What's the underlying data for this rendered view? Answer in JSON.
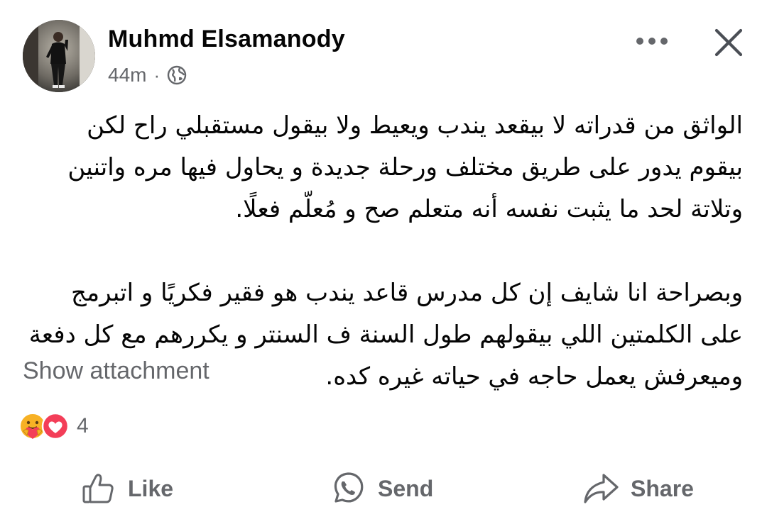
{
  "post": {
    "author": "Muhmd Elsamanody",
    "time": "44m",
    "separator": "·",
    "privacy_icon": "globe-icon",
    "paragraphs": [
      [
        "الواثق من قدراته لا بيقعد يندب ويعيط ولا بيقول مستقبلي راح لكن",
        "بيقوم يدور على طريق مختلف ورحلة جديدة و يحاول فيها مره واتنين",
        "وتلاتة لحد ما يثبت نفسه أنه متعلم صح و مُعلّم فعلًا."
      ],
      [
        "وبصراحة انا شايف إن كل مدرس قاعد يندب هو فقير فكريًا و اتبرمج",
        "على الكلمتين اللي بيقولهم طول السنة ف السنتر و يكررهم مع كل دفعة",
        "وميعرفش يعمل حاجه في حياته غيره كده."
      ]
    ],
    "show_attachment": "Show attachment"
  },
  "reactions": {
    "icons": [
      "care-reaction-icon",
      "love-reaction-icon"
    ],
    "count": "4"
  },
  "actions": {
    "like": "Like",
    "send": "Send",
    "share": "Share"
  },
  "colors": {
    "primary_text": "#050505",
    "secondary_text": "#65676b",
    "love_red": "#f33e58",
    "care_yellow": "#f7b125"
  }
}
